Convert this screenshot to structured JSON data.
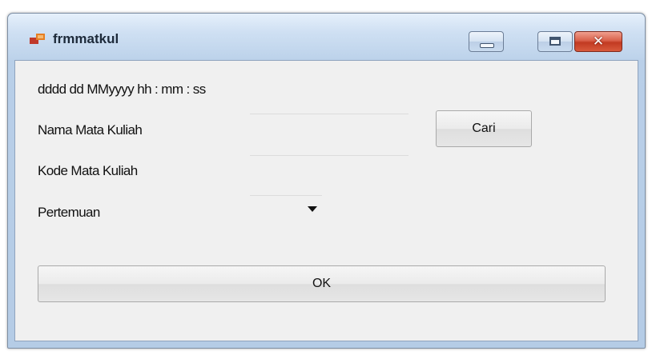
{
  "window": {
    "title": "frmmatkul"
  },
  "form": {
    "datetime_format": "dddd  dd MMyyyy   hh : mm : ss",
    "nama_label": "Nama Mata Kuliah",
    "kode_label": "Kode Mata Kuliah",
    "pertemuan_label": "Pertemuan",
    "nama_value": "",
    "kode_value": "",
    "pertemuan_value": "",
    "cari_label": "Cari",
    "ok_label": "OK"
  },
  "colors": {
    "frame": "#b9cfe8",
    "client": "#f0f0f0",
    "close_button": "#c23a22"
  },
  "icons": {
    "app": "app-icon",
    "minimize": "minimize-icon",
    "maximize": "maximize-icon",
    "close": "close-icon",
    "dropdown": "chevron-down-icon"
  }
}
